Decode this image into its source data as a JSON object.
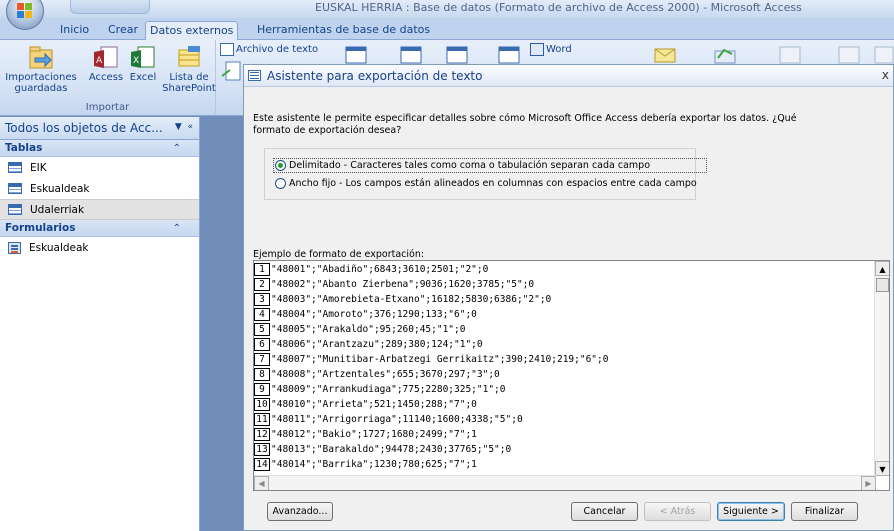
{
  "window": {
    "title": "EUSKAL HERRIA : Base de datos (Formato de archivo de Access 2000) - Microsoft Access"
  },
  "tabs": [
    {
      "label": "Inicio"
    },
    {
      "label": "Crear"
    },
    {
      "label": "Datos externos"
    },
    {
      "label": "Herramientas de base de datos"
    }
  ],
  "ribbon": {
    "import_group": {
      "label": "Importar",
      "saved_imports": "Importaciones guardadas",
      "access": "Access",
      "excel": "Excel",
      "sharepoint": "Lista de SharePoint"
    },
    "export": {
      "text_file": "Archivo de texto",
      "word": "Word"
    }
  },
  "nav": {
    "header": "Todos los objetos de Acc...",
    "sections": [
      {
        "title": "Tablas",
        "items": [
          "EIK",
          "Eskualdeak",
          "Udalerriak"
        ],
        "selected": 2
      },
      {
        "title": "Formularios",
        "items": [
          "Eskualdeak"
        ]
      }
    ]
  },
  "dialog": {
    "title": "Asistente para exportación de texto",
    "intro": "Este asistente le permite especificar detalles sobre cómo Microsoft Office Access debería exportar los datos. ¿Qué formato de exportación desea?",
    "option_delimited": "Delimitado - Caracteres tales como coma o tabulación separan cada campo",
    "option_fixed": "Ancho fijo - Los campos están alineados en columnas con espacios entre cada campo",
    "selected_option": "delimited",
    "sample_label": "Ejemplo de formato de exportación:",
    "sample_rows": [
      {
        "n": "1",
        "text": "\"48001\";\"Abadiño\";6843;3610;2501;\"2\";0"
      },
      {
        "n": "2",
        "text": "\"48002\";\"Abanto Zierbena\";9036;1620;3785;\"5\";0"
      },
      {
        "n": "3",
        "text": "\"48003\";\"Amorebieta-Etxano\";16182;5830;6386;\"2\";0"
      },
      {
        "n": "4",
        "text": "\"48004\";\"Amoroto\";376;1290;133;\"6\";0"
      },
      {
        "n": "5",
        "text": "\"48005\";\"Arakaldo\";95;260;45;\"1\";0"
      },
      {
        "n": "6",
        "text": "\"48006\";\"Arantzazu\";289;380;124;\"1\";0"
      },
      {
        "n": "7",
        "text": "\"48007\";\"Munitibar-Arbatzegi Gerrikaitz\";390;2410;219;\"6\";0"
      },
      {
        "n": "8",
        "text": "\"48008\";\"Artzentales\";655;3670;297;\"3\";0"
      },
      {
        "n": "9",
        "text": "\"48009\";\"Arrankudiaga\";775;2280;325;\"1\";0"
      },
      {
        "n": "10",
        "text": "\"48010\";\"Arrieta\";521;1450;288;\"7\";0"
      },
      {
        "n": "11",
        "text": "\"48011\";\"Arrigorriaga\";11140;1600;4338;\"5\";0"
      },
      {
        "n": "12",
        "text": "\"48012\";\"Bakio\";1727;1680;2499;\"7\";1"
      },
      {
        "n": "13",
        "text": "\"48013\";\"Barakaldo\";94478;2430;37765;\"5\";0"
      },
      {
        "n": "14",
        "text": "\"48014\";\"Barrika\";1230;780;625;\"7\";1"
      }
    ],
    "buttons": {
      "advanced": "Avanzado...",
      "cancel": "Cancelar",
      "back": "< Atrás",
      "next": "Siguiente >",
      "finish": "Finalizar"
    }
  },
  "colors": {
    "ribbon_text": "#15428b",
    "radio_selected": "#21a121"
  }
}
